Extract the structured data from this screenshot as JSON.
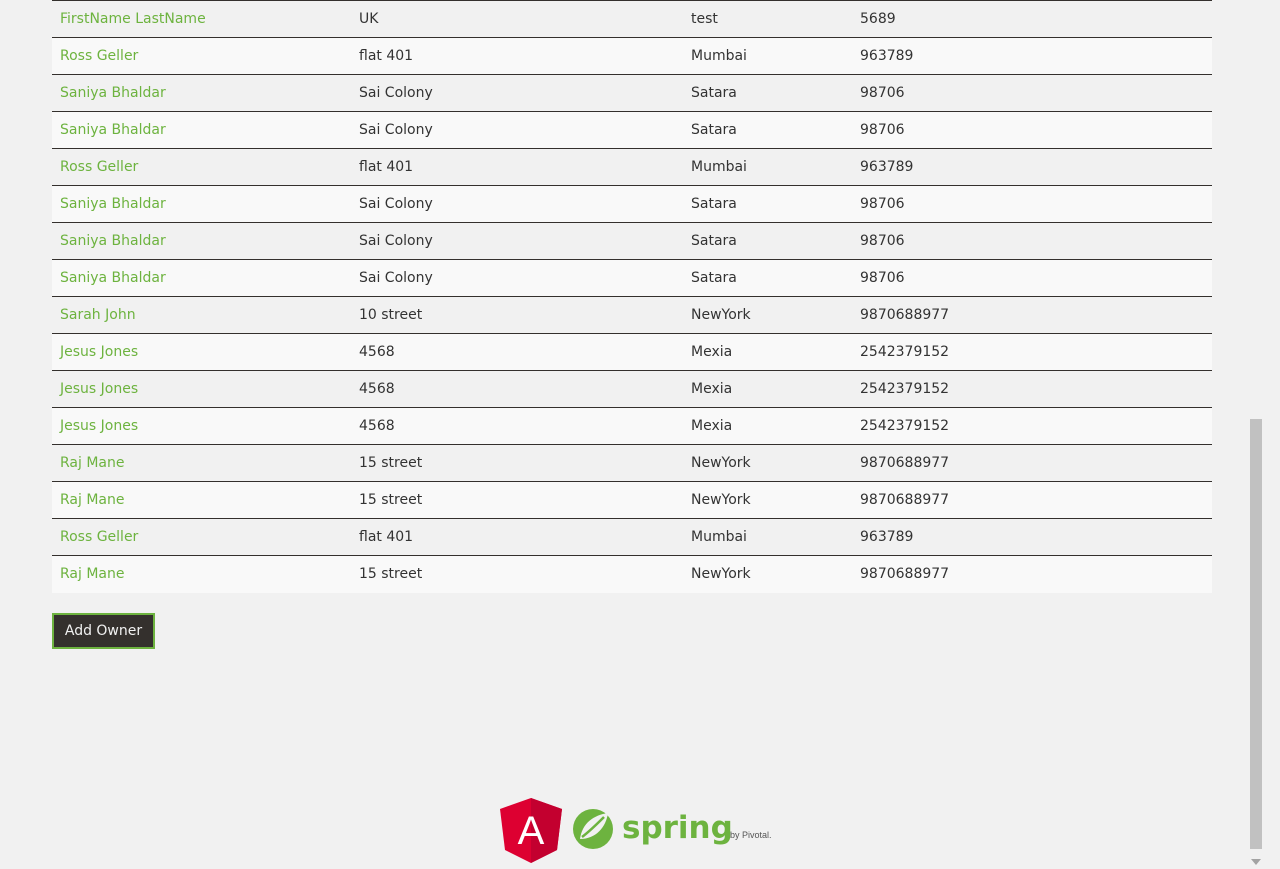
{
  "owners": [
    {
      "name": "FirstName LastName",
      "address": "UK",
      "city": "test",
      "telephone": "5689"
    },
    {
      "name": "Ross Geller",
      "address": "flat 401",
      "city": "Mumbai",
      "telephone": "963789"
    },
    {
      "name": "Saniya Bhaldar",
      "address": "Sai Colony",
      "city": "Satara",
      "telephone": "98706"
    },
    {
      "name": "Saniya Bhaldar",
      "address": "Sai Colony",
      "city": "Satara",
      "telephone": "98706"
    },
    {
      "name": "Ross Geller",
      "address": "flat 401",
      "city": "Mumbai",
      "telephone": "963789"
    },
    {
      "name": "Saniya Bhaldar",
      "address": "Sai Colony",
      "city": "Satara",
      "telephone": "98706"
    },
    {
      "name": "Saniya Bhaldar",
      "address": "Sai Colony",
      "city": "Satara",
      "telephone": "98706"
    },
    {
      "name": "Saniya Bhaldar",
      "address": "Sai Colony",
      "city": "Satara",
      "telephone": "98706"
    },
    {
      "name": "Sarah John",
      "address": "10 street",
      "city": "NewYork",
      "telephone": "9870688977"
    },
    {
      "name": "Jesus Jones",
      "address": "4568",
      "city": "Mexia",
      "telephone": "2542379152"
    },
    {
      "name": "Jesus Jones",
      "address": "4568",
      "city": "Mexia",
      "telephone": "2542379152"
    },
    {
      "name": "Jesus Jones",
      "address": "4568",
      "city": "Mexia",
      "telephone": "2542379152"
    },
    {
      "name": "Raj Mane",
      "address": "15 street",
      "city": "NewYork",
      "telephone": "9870688977"
    },
    {
      "name": "Raj Mane",
      "address": "15 street",
      "city": "NewYork",
      "telephone": "9870688977"
    },
    {
      "name": "Ross Geller",
      "address": "flat 401",
      "city": "Mumbai",
      "telephone": "963789"
    },
    {
      "name": "Raj Mane",
      "address": "15 street",
      "city": "NewYork",
      "telephone": "9870688977"
    }
  ],
  "add_owner_label": "Add Owner",
  "footer": {
    "angular_logo_letter": "A",
    "spring_wordmark": "spring",
    "pivotal_text": "by Pivotal."
  },
  "colors": {
    "link_green": "#6db33f",
    "button_dark": "#34302d",
    "angular_red": "#dd0031",
    "angular_dark_red": "#c3002f"
  }
}
